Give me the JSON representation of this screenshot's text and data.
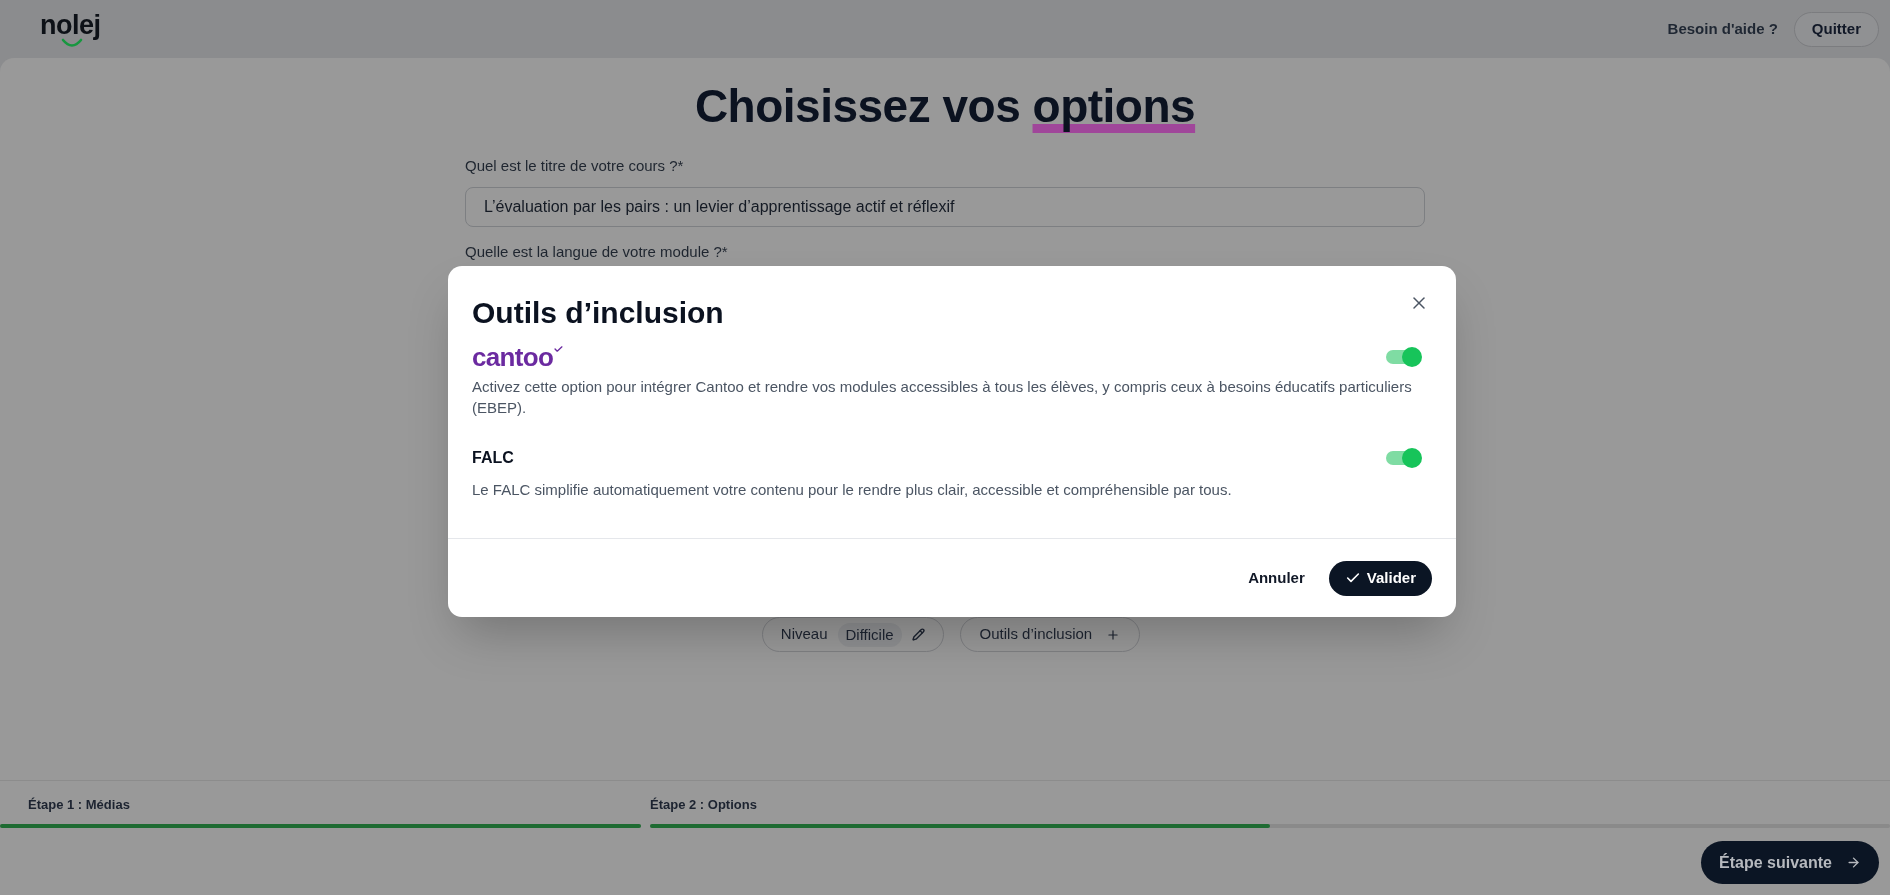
{
  "header": {
    "logo": "nolej",
    "help_link": "Besoin d'aide ?",
    "quit_button": "Quitter"
  },
  "page": {
    "title": "Choisissez vos",
    "title_highlight": "options"
  },
  "form": {
    "title_field": {
      "label": "Quel est le titre de votre cours ?*",
      "value": "L’évaluation par les pairs : un levier d’apprentissage actif et réflexif"
    },
    "language_label": "Quelle est la langue de votre module ?*"
  },
  "option_chips": [
    {
      "kind": "value",
      "label": "Niveau",
      "value": "Difficile"
    },
    {
      "kind": "add",
      "label": "Outils d’inclusion"
    }
  ],
  "modal": {
    "title": "Outils d’inclusion",
    "options": [
      {
        "kind": "logo",
        "logo": "cantoo",
        "on": true,
        "description": "Activez cette option pour intégrer Cantoo et rendre vos modules accessibles à tous les élèves, y compris ceux à besoins éducatifs particuliers (EBEP)."
      },
      {
        "kind": "name",
        "name": "FALC",
        "on": true,
        "description": "Le FALC simplifie automatiquement votre contenu pour le rendre plus clair, accessible et compréhensible par tous."
      }
    ],
    "cancel_button": "Annuler",
    "confirm_button": "Valider"
  },
  "steps": [
    {
      "label": "Étape 1 : Médias",
      "level": 1
    },
    {
      "label": "Étape 2 : Options",
      "level": 0.5
    }
  ],
  "next_button": "Étape suivante"
}
